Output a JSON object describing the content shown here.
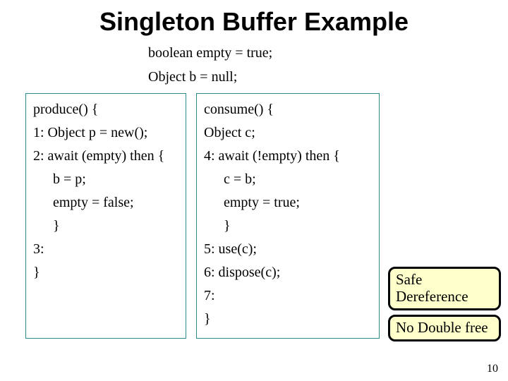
{
  "title": "Singleton Buffer Example",
  "decls": {
    "line1": "boolean empty = true;",
    "line2": "Object b = null;"
  },
  "produce": {
    "l0": "produce() {",
    "l1": "1: Object p = new();",
    "l2": "2: await (empty) then {",
    "l3": "b = p;",
    "l4": "empty = false;",
    "l5": "}",
    "l6": "3:",
    "l7": "}"
  },
  "consume": {
    "l0": "consume() {",
    "l1": "Object c;",
    "l2": "4: await (!empty) then {",
    "l3": "c = b;",
    "l4": "empty = true;",
    "l5": "}",
    "l6": "5: use(c);",
    "l7": "6: dispose(c);",
    "l8": "7:",
    "l9": "}"
  },
  "callouts": {
    "safe": "Safe Dereference",
    "nodouble": "No Double free"
  },
  "pagenum": "10"
}
